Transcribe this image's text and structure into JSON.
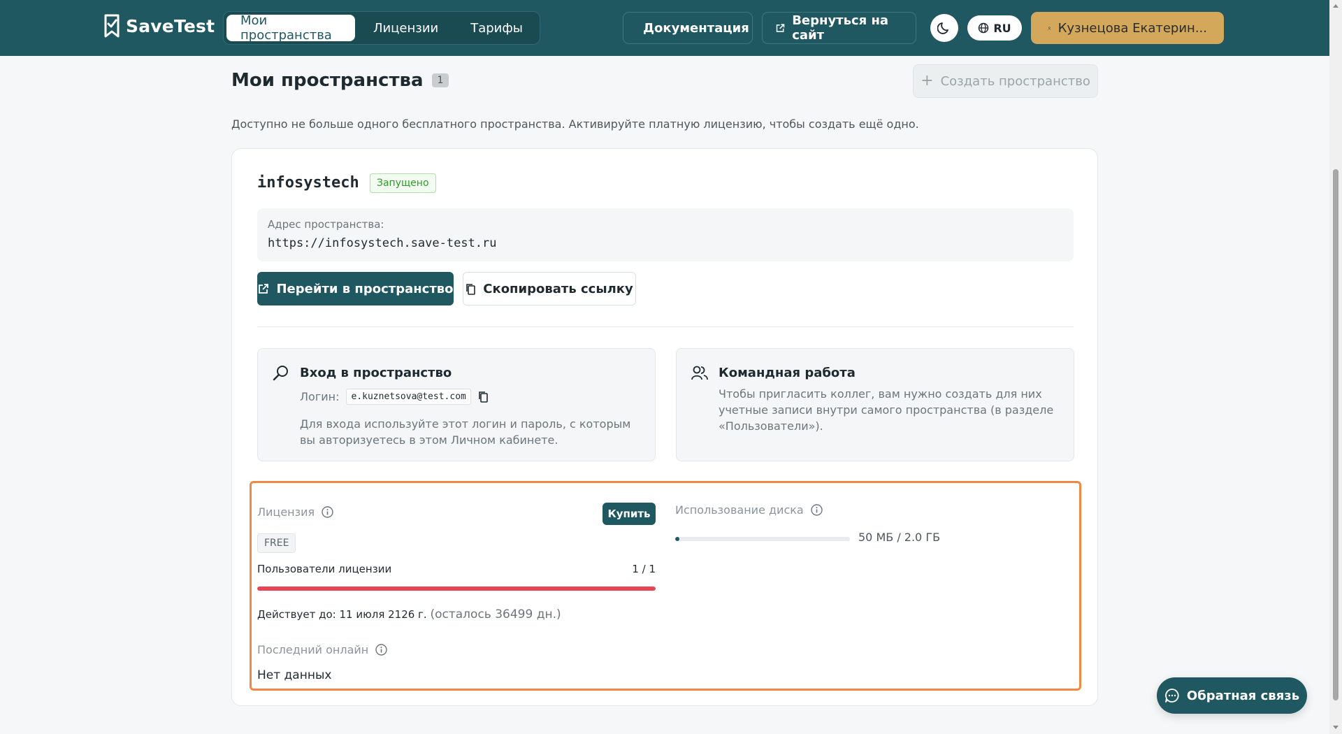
{
  "header": {
    "logo_text": "SaveTest",
    "nav": [
      "Мои пространства",
      "Лицензии",
      "Тарифы"
    ],
    "docs_label": "Документация",
    "back_label": "Вернуться на сайт",
    "lang_label": "RU",
    "user_label": "Кузнецова Екатерин..."
  },
  "page": {
    "title": "Мои пространства",
    "count": "1",
    "create_label": "Создать пространство",
    "notice": "Доступно не больше одного бесплатного пространства. Активируйте платную лицензию, чтобы создать ещё одно."
  },
  "space": {
    "name": "infosystech",
    "status": "Запущено",
    "address_label": "Адрес пространства:",
    "address": "https://infosystech.save-test.ru",
    "go_label": "Перейти в пространство",
    "copy_label": "Скопировать ссылку"
  },
  "login_box": {
    "title": "Вход в пространство",
    "login_label": "Логин:",
    "login": "e.kuznetsova@test.com",
    "desc": "Для входа используйте этот логин и пароль, с которым вы авторизуетесь в этом Личном кабинете."
  },
  "team_box": {
    "title": "Командная работа",
    "desc": "Чтобы пригласить коллег, вам нужно создать для них учетные записи внутри самого пространства (в разделе «Пользователи»)."
  },
  "license": {
    "label": "Лицензия",
    "buy_label": "Купить",
    "plan": "FREE",
    "users_label": "Пользователи лицензии",
    "users_value": "1 / 1",
    "users_fraction": 1.0,
    "valid_prefix": "Действует до: 11 июля 2126 г.",
    "valid_rest": "(осталось 36499 дн.)",
    "last_online_label": "Последний онлайн",
    "last_online_value": "Нет данных"
  },
  "disk": {
    "label": "Использование диска",
    "value": "50 МБ / 2.0 ГБ",
    "fraction": 0.024
  },
  "feedback_label": "Обратная связь",
  "colors": {
    "brand": "#205861",
    "accent": "#d4a85b",
    "danger": "#e94356",
    "success": "#2f9a27",
    "highlight": "#ee8a45"
  }
}
